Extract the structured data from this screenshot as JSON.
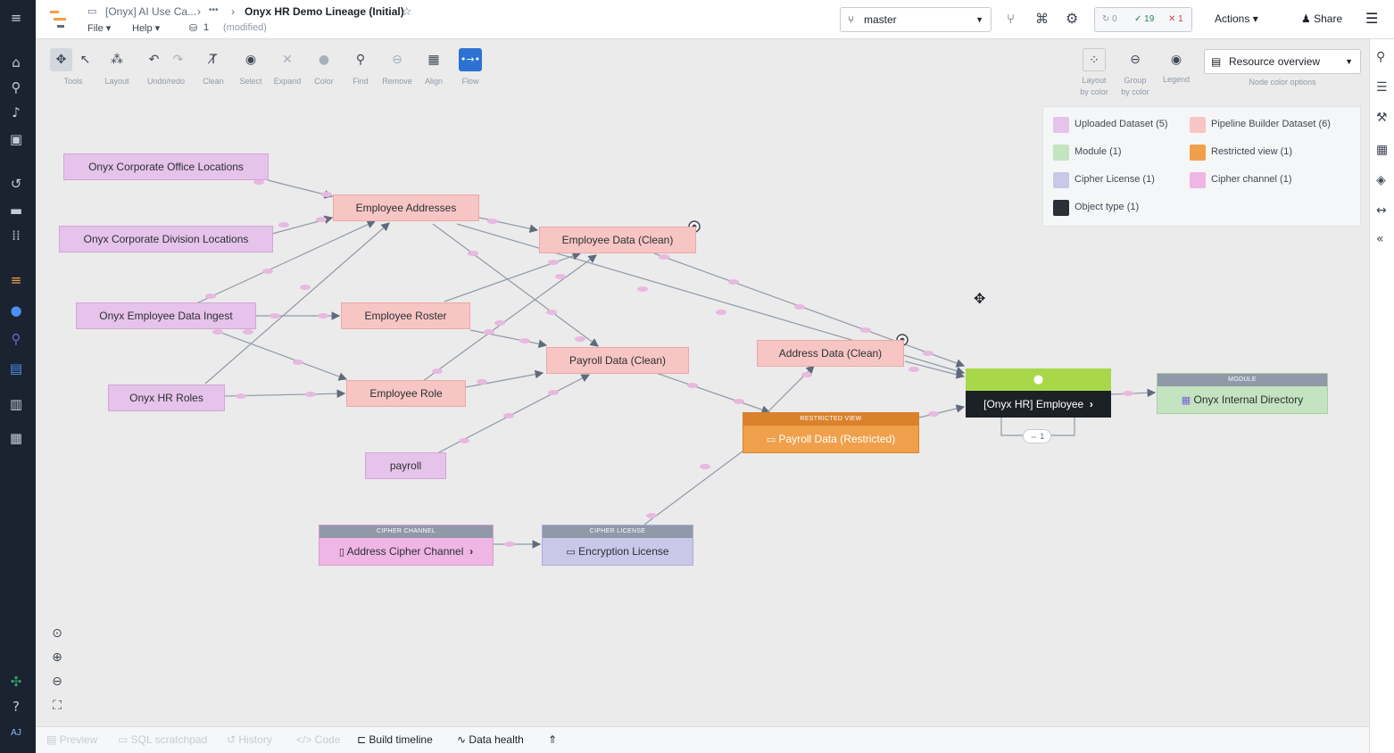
{
  "breadcrumb": {
    "parent": "[Onyx] AI Use Ca...",
    "ellipsis": "•••",
    "title": "Onyx HR Demo Lineage (Initial)",
    "menu_file": "File",
    "menu_help": "Help",
    "counter": "1",
    "status": "(modified)"
  },
  "topbar": {
    "branch": "master",
    "checks_pending": "0",
    "checks_passed": "19",
    "checks_failed": "1",
    "actions_label": "Actions",
    "share_label": "Share"
  },
  "toolbar": {
    "tools": [
      "Tools",
      "Layout",
      "Undo/redo",
      "Clean",
      "Select",
      "Expand",
      "Color",
      "Find",
      "Remove",
      "Align",
      "Flow"
    ],
    "layout_by_color": "Layout\nby color",
    "group_by_color": "Group\nby color",
    "legend": "Legend",
    "color_option": "Resource overview",
    "color_option_caption": "Node color options"
  },
  "legend": {
    "items": [
      {
        "label": "Uploaded Dataset (5)",
        "color": "#e6c3ea"
      },
      {
        "label": "Pipeline Builder Dataset (6)",
        "color": "#f7c6c4"
      },
      {
        "label": "Module (1)",
        "color": "#c4e3c0"
      },
      {
        "label": "Restricted view (1)",
        "color": "#f0a04b"
      },
      {
        "label": "Cipher License (1)",
        "color": "#c9c8e8"
      },
      {
        "label": "Cipher channel (1)",
        "color": "#efb5e5"
      },
      {
        "label": "Object type (1)",
        "color": "#2a2f35"
      }
    ]
  },
  "nodes": {
    "office_locations": "Onyx Corporate Office Locations",
    "division_locations": "Onyx Corporate Division Locations",
    "employee_ingest": "Onyx Employee Data Ingest",
    "hr_roles": "Onyx HR Roles",
    "employee_addresses": "Employee Addresses",
    "employee_roster": "Employee Roster",
    "employee_role": "Employee Role",
    "payroll": "payroll",
    "employee_data_clean": "Employee Data (Clean)",
    "payroll_data_clean": "Payroll Data (Clean)",
    "address_data_clean": "Address Data (Clean)",
    "restricted_header": "RESTRICTED VIEW",
    "payroll_restricted": "Payroll Data (Restricted)",
    "object_type": "[Onyx HR] Employee",
    "object_badge": "1",
    "module_header": "MODULE",
    "module_name": "Onyx Internal Directory",
    "cipher_channel_header": "CIPHER CHANNEL",
    "cipher_channel": "Address Cipher Channel",
    "cipher_license_header": "CIPHER LICENSE",
    "cipher_license": "Encryption License"
  },
  "bottom_tabs": [
    "Preview",
    "SQL scratchpad",
    "History",
    "Code",
    "Build timeline",
    "Data health"
  ],
  "user_initials": "AJ",
  "colors": {
    "accent": "#2d72d2",
    "object_green": "#a8d84a",
    "restricted_orange": "#f0a04b",
    "edge": "#8f99a8",
    "edge_dot": "#e8b8e0"
  }
}
